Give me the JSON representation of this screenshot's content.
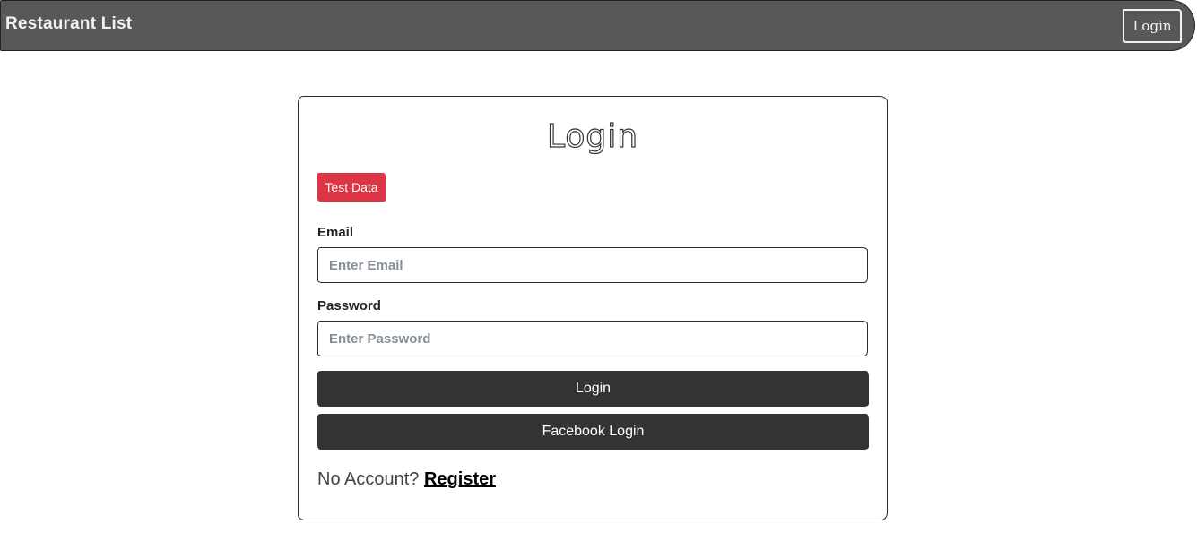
{
  "navbar": {
    "brand": "Restaurant List",
    "login_label": "Login"
  },
  "card": {
    "title": "Login",
    "test_data_label": "Test Data",
    "email": {
      "label": "Email",
      "placeholder": "Enter Email",
      "value": ""
    },
    "password": {
      "label": "Password",
      "placeholder": "Enter Password",
      "value": ""
    },
    "login_button": "Login",
    "facebook_button": "Facebook Login",
    "footer": {
      "prompt": "No Account?",
      "register_link": "Register"
    }
  },
  "colors": {
    "navbar_bg": "#585858",
    "danger": "#dc3545",
    "dark_button": "#333333"
  }
}
